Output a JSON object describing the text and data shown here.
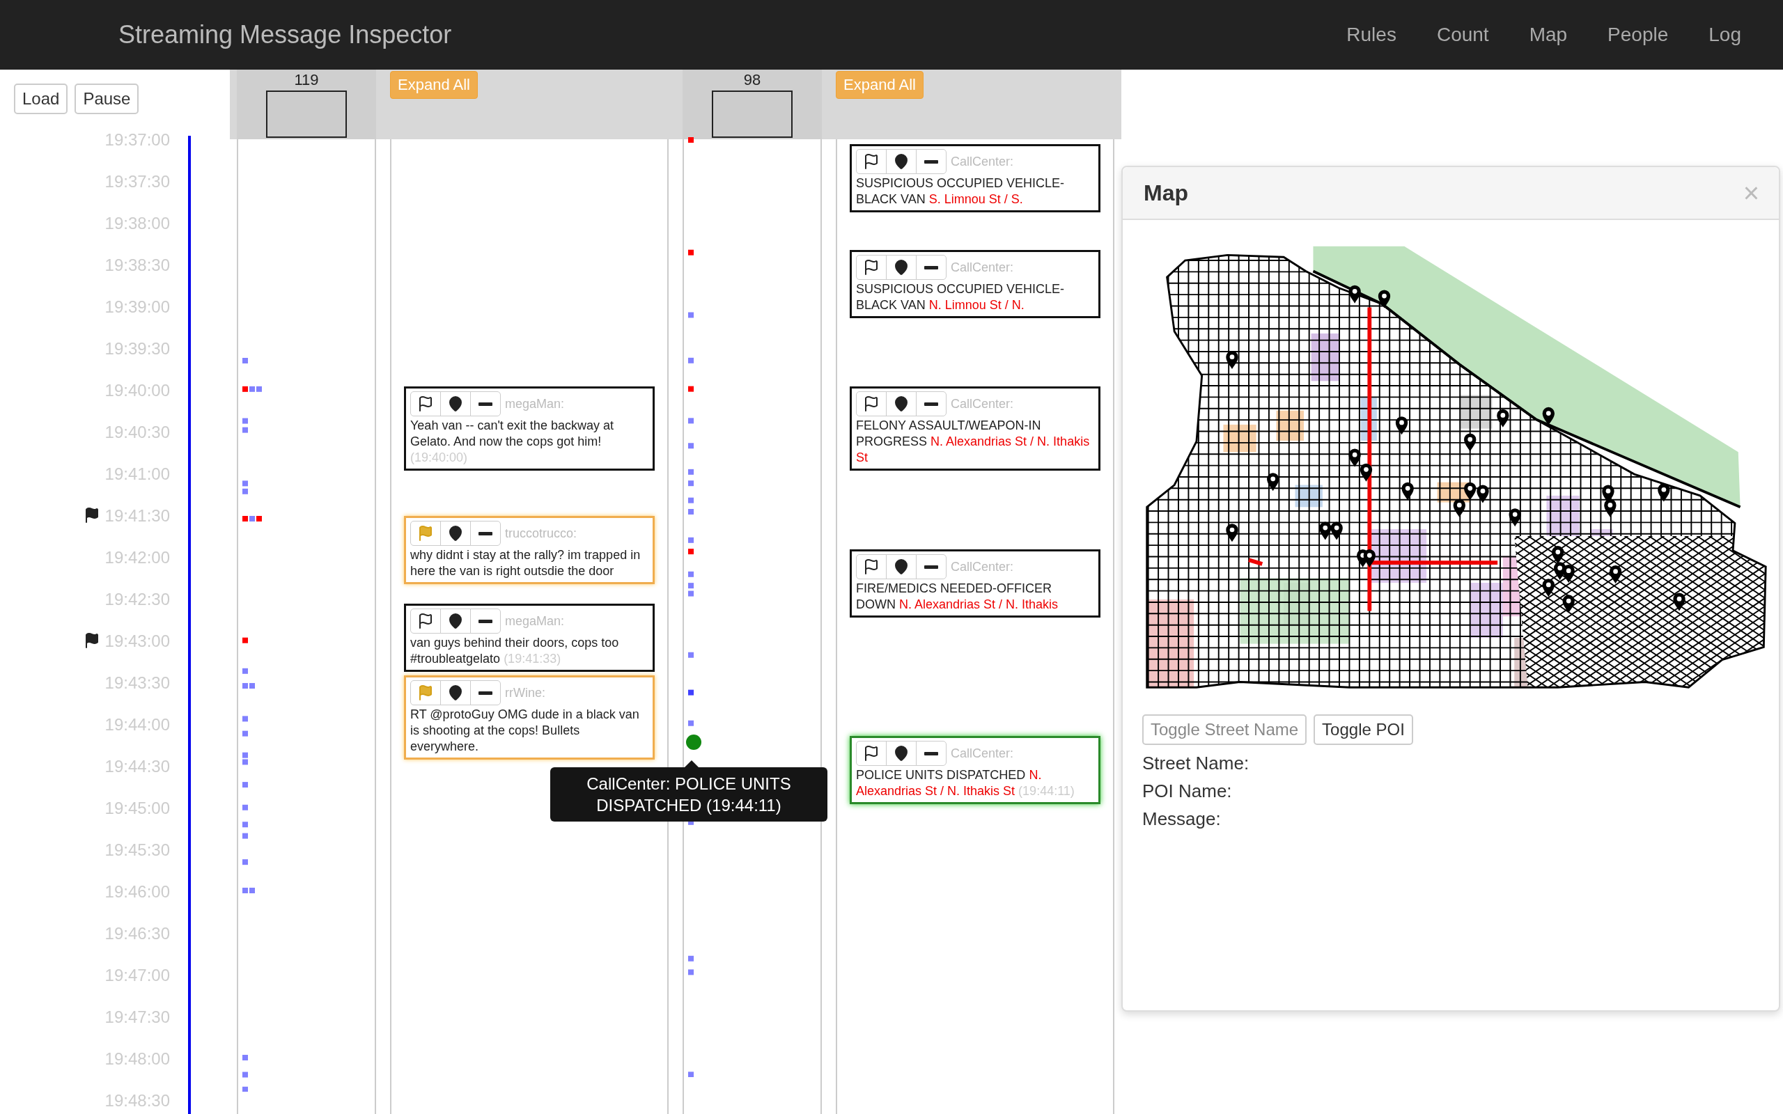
{
  "navbar": {
    "title": "Streaming Message Inspector",
    "links": [
      "Rules",
      "Count",
      "Map",
      "People",
      "Log"
    ]
  },
  "controls": [
    "Load",
    "Pause"
  ],
  "time_axis": [
    {
      "label": "19:37:00",
      "flagged": false
    },
    {
      "label": "19:37:30",
      "flagged": false
    },
    {
      "label": "19:38:00",
      "flagged": false
    },
    {
      "label": "19:38:30",
      "flagged": false
    },
    {
      "label": "19:39:00",
      "flagged": false
    },
    {
      "label": "19:39:30",
      "flagged": false
    },
    {
      "label": "19:40:00",
      "flagged": false
    },
    {
      "label": "19:40:30",
      "flagged": false
    },
    {
      "label": "19:41:00",
      "flagged": false
    },
    {
      "label": "19:41:30",
      "flagged": true
    },
    {
      "label": "19:42:00",
      "flagged": false
    },
    {
      "label": "19:42:30",
      "flagged": false
    },
    {
      "label": "19:43:00",
      "flagged": true
    },
    {
      "label": "19:43:30",
      "flagged": false
    },
    {
      "label": "19:44:00",
      "flagged": false
    },
    {
      "label": "19:44:30",
      "flagged": false
    },
    {
      "label": "19:45:00",
      "flagged": false
    },
    {
      "label": "19:45:30",
      "flagged": false
    },
    {
      "label": "19:46:00",
      "flagged": false
    },
    {
      "label": "19:46:30",
      "flagged": false
    },
    {
      "label": "19:47:00",
      "flagged": false
    },
    {
      "label": "19:47:30",
      "flagged": false
    },
    {
      "label": "19:48:00",
      "flagged": false
    },
    {
      "label": "19:48:30",
      "flagged": false
    }
  ],
  "streams": [
    {
      "count": "119",
      "expand_label": "Expand All",
      "messages": [
        {
          "user": "megaMan:",
          "text": "Yeah van -- can't exit the backway at Gelato. And now the cops got him!",
          "time": "(19:40:00)",
          "flagged": false,
          "selected": false
        },
        {
          "user": "truccotrucco:",
          "text": "why didnt i stay at the rally? im trapped in here the van is right outsdie the door",
          "flagged": true,
          "selected": false
        },
        {
          "user": "megaMan:",
          "text": "van guys behind their doors, cops too #troubleatgelato",
          "time": "(19:41:33)",
          "flagged": false,
          "selected": false
        },
        {
          "user": "rrWine:",
          "text": "RT @protoGuy OMG dude in a black van is shooting at the cops! Bullets everywhere.",
          "flagged": true,
          "selected": false
        }
      ]
    },
    {
      "count": "98",
      "expand_label": "Expand All",
      "messages": [
        {
          "user": "CallCenter:",
          "text": "SUSPICIOUS OCCUPIED VEHICLE-BLACK VAN",
          "location": "S. Limnou St / S.",
          "flagged": false,
          "selected": false
        },
        {
          "user": "CallCenter:",
          "text": "SUSPICIOUS OCCUPIED VEHICLE-BLACK VAN",
          "location": "N. Limnou St / N.",
          "flagged": false,
          "selected": false
        },
        {
          "user": "CallCenter:",
          "text": "FELONY ASSAULT/WEAPON-IN PROGRESS",
          "location": "N. Alexandrias St / N. Ithakis St",
          "flagged": false,
          "selected": false
        },
        {
          "user": "CallCenter:",
          "text": "FIRE/MEDICS NEEDED-OFFICER DOWN",
          "location": "N. Alexandrias St / N. Ithakis",
          "flagged": false,
          "selected": false
        },
        {
          "user": "CallCenter:",
          "text": "POLICE UNITS DISPATCHED",
          "location": "N. Alexandrias St / N. Ithakis St",
          "time": "(19:44:11)",
          "flagged": false,
          "selected": true
        }
      ]
    }
  ],
  "tooltip": {
    "text": "CallCenter: POLICE UNITS DISPATCHED (19:44:11)"
  },
  "map_panel": {
    "title": "Map",
    "close": "×",
    "buttons": [
      {
        "label": "Toggle Street Name",
        "disabled": true
      },
      {
        "label": "Toggle POI",
        "disabled": false
      }
    ],
    "fields": [
      "Street Name:",
      "POI Name:",
      "Message:"
    ]
  }
}
